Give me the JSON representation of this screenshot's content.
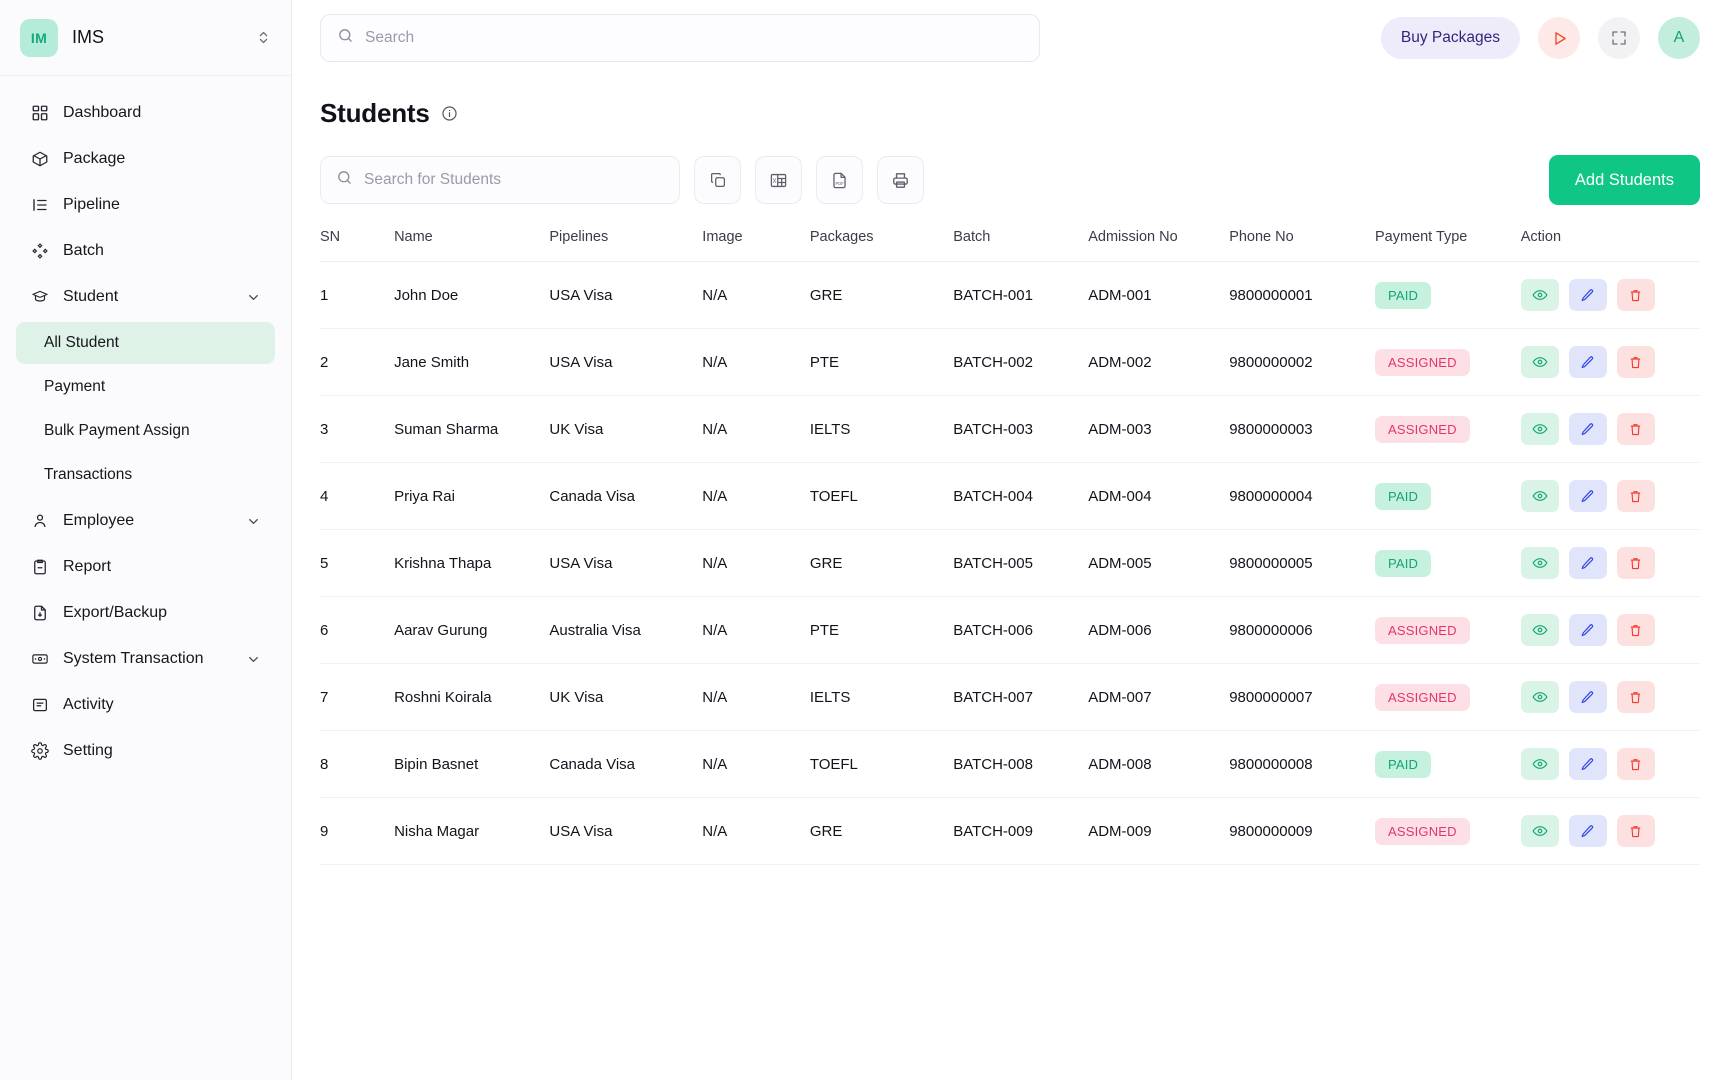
{
  "sidebar": {
    "brand": {
      "badge": "IM",
      "name": "IMS",
      "caret_icon": "chevron-up-down-icon"
    },
    "items": [
      {
        "label": "Dashboard",
        "icon": "dashboard-grid-icon",
        "expandable": false
      },
      {
        "label": "Package",
        "icon": "package-box-icon",
        "expandable": false
      },
      {
        "label": "Pipeline",
        "icon": "pipeline-list-icon",
        "expandable": false
      },
      {
        "label": "Batch",
        "icon": "batch-nodes-icon",
        "expandable": false
      },
      {
        "label": "Student",
        "icon": "graduation-cap-icon",
        "expandable": true
      },
      {
        "label": "Employee",
        "icon": "user-icon",
        "expandable": true
      },
      {
        "label": "Report",
        "icon": "clipboard-icon",
        "expandable": false
      },
      {
        "label": "Export/Backup",
        "icon": "file-download-icon",
        "expandable": false
      },
      {
        "label": "System Transaction",
        "icon": "money-card-icon",
        "expandable": true
      },
      {
        "label": "Activity",
        "icon": "activity-document-icon",
        "expandable": false
      },
      {
        "label": "Setting",
        "icon": "gear-icon",
        "expandable": false
      }
    ],
    "student_subitems": [
      {
        "label": "All Student",
        "active": true
      },
      {
        "label": "Payment",
        "active": false
      },
      {
        "label": "Bulk Payment Assign",
        "active": false
      },
      {
        "label": "Transactions",
        "active": false
      }
    ]
  },
  "topbar": {
    "search_placeholder": "Search",
    "search_value": "",
    "search_icon": "search-icon",
    "buy_packages_label": "Buy Packages",
    "play_icon": "play-icon",
    "expand_icon": "fullscreen-expand-icon",
    "avatar_initial": "A"
  },
  "page": {
    "title": "Students",
    "info_icon": "info-circle-icon"
  },
  "toolbar": {
    "search_placeholder": "Search for Students",
    "search_value": "",
    "search_icon": "search-icon",
    "copy_icon": "copy-icon",
    "excel_icon": "excel-file-icon",
    "pdf_icon": "pdf-file-icon",
    "print_icon": "printer-icon",
    "add_students_label": "Add Students"
  },
  "table": {
    "headers": [
      "SN",
      "Name",
      "Pipelines",
      "Image",
      "Packages",
      "Batch",
      "Admission No",
      "Phone No",
      "Payment Type",
      "Action"
    ],
    "action_icons": {
      "view": "eye-icon",
      "edit": "pencil-icon",
      "delete": "trash-icon"
    },
    "rows": [
      {
        "sn": "1",
        "name": "John Doe",
        "pipeline": "USA Visa",
        "image": "N/A",
        "package": "GRE",
        "batch": "BATCH-001",
        "admission": "ADM-001",
        "phone": "9800000001",
        "payment": "PAID"
      },
      {
        "sn": "2",
        "name": "Jane Smith",
        "pipeline": "USA Visa",
        "image": "N/A",
        "package": "PTE",
        "batch": "BATCH-002",
        "admission": "ADM-002",
        "phone": "9800000002",
        "payment": "ASSIGNED"
      },
      {
        "sn": "3",
        "name": "Suman Sharma",
        "pipeline": "UK Visa",
        "image": "N/A",
        "package": "IELTS",
        "batch": "BATCH-003",
        "admission": "ADM-003",
        "phone": "9800000003",
        "payment": "ASSIGNED"
      },
      {
        "sn": "4",
        "name": "Priya Rai",
        "pipeline": "Canada Visa",
        "image": "N/A",
        "package": "TOEFL",
        "batch": "BATCH-004",
        "admission": "ADM-004",
        "phone": "9800000004",
        "payment": "PAID"
      },
      {
        "sn": "5",
        "name": "Krishna Thapa",
        "pipeline": "USA Visa",
        "image": "N/A",
        "package": "GRE",
        "batch": "BATCH-005",
        "admission": "ADM-005",
        "phone": "9800000005",
        "payment": "PAID"
      },
      {
        "sn": "6",
        "name": "Aarav Gurung",
        "pipeline": "Australia Visa",
        "image": "N/A",
        "package": "PTE",
        "batch": "BATCH-006",
        "admission": "ADM-006",
        "phone": "9800000006",
        "payment": "ASSIGNED"
      },
      {
        "sn": "7",
        "name": "Roshni Koirala",
        "pipeline": "UK Visa",
        "image": "N/A",
        "package": "IELTS",
        "batch": "BATCH-007",
        "admission": "ADM-007",
        "phone": "9800000007",
        "payment": "ASSIGNED"
      },
      {
        "sn": "8",
        "name": "Bipin Basnet",
        "pipeline": "Canada Visa",
        "image": "N/A",
        "package": "TOEFL",
        "batch": "BATCH-008",
        "admission": "ADM-008",
        "phone": "9800000008",
        "payment": "PAID"
      },
      {
        "sn": "9",
        "name": "Nisha Magar",
        "pipeline": "USA Visa",
        "image": "N/A",
        "package": "GRE",
        "batch": "BATCH-009",
        "admission": "ADM-009",
        "phone": "9800000009",
        "payment": "ASSIGNED"
      }
    ]
  },
  "colors": {
    "brand_green": "#10c685",
    "badge_paid_bg": "#c6f1de",
    "badge_paid_text": "#11a673",
    "badge_assigned_bg": "#fce0e6",
    "badge_assigned_text": "#e4356b",
    "active_nav_bg": "#dff2e7",
    "buy_packages_bg": "#eeecfb",
    "buy_packages_text": "#36237e"
  }
}
